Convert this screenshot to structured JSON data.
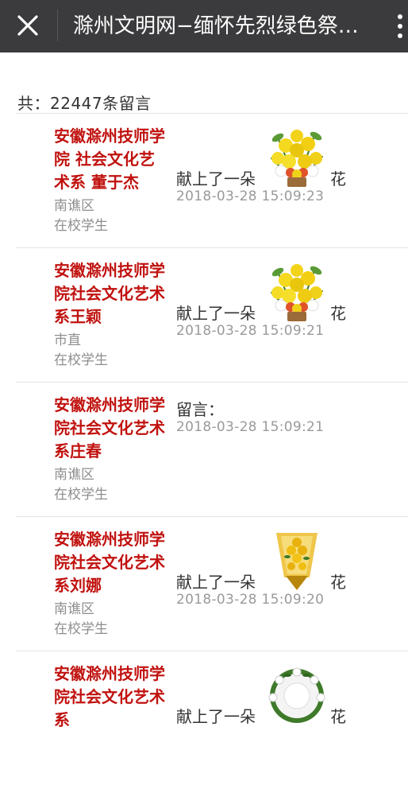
{
  "header": {
    "title": "滁州文明网−缅怀先烈绿色祭…",
    "close_icon": "close-icon",
    "more_icon": "more-vertical-icon",
    "background": "#3b3b3d"
  },
  "summary": {
    "count_text": "共：22447条留言"
  },
  "colors": {
    "name": "#c0120f",
    "meta": "#8e8e8e",
    "time": "#9a9a9a"
  },
  "messages": [
    {
      "name": "安徽滁州技师学院 社会文化艺术系 董于杰",
      "region": "南谯区",
      "role": "在校学生",
      "action": "献上了一朵",
      "flower": "yellow-chrysanthemum-basket",
      "suffix": "花",
      "time": "2018-03-28 15:09:23"
    },
    {
      "name": "安徽滁州技师学院社会文化艺术系王颖",
      "region": "市直",
      "role": "在校学生",
      "action": "献上了一朵",
      "flower": "yellow-chrysanthemum-basket",
      "suffix": "花",
      "time": "2018-03-28 15:09:21"
    },
    {
      "name": "安徽滁州技师学院社会文化艺术系庄春",
      "region": "南谯区",
      "role": "在校学生",
      "action": "留言：",
      "flower": "",
      "suffix": "",
      "time": "2018-03-28 15:09:21"
    },
    {
      "name": "安徽滁州技师学院社会文化艺术系刘娜",
      "region": "南谯区",
      "role": "在校学生",
      "action": "献上了一朵",
      "flower": "chrysanthemum-bouquet",
      "suffix": "花",
      "time": "2018-03-28 15:09:20"
    },
    {
      "name": "安徽滁州技师学院社会文化艺术系",
      "region": "",
      "role": "",
      "action": "献上了一朵",
      "flower": "white-flower-wreath",
      "suffix": "花",
      "time": ""
    }
  ]
}
